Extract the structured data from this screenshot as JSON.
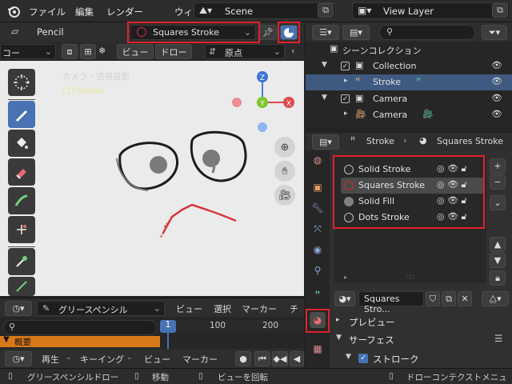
{
  "menubar": {
    "items": [
      "ファイル",
      "編集",
      "レンダー",
      "ウィンド"
    ],
    "scene": "Scene",
    "view_layer": "View Layer"
  },
  "viewport": {
    "editor_mode": "Pencil",
    "material_selector": "Squares Stroke",
    "mode_dropdown": "コー",
    "view_button": "ビュー",
    "draw_button": "ドロー",
    "origin_dropdown": "原点",
    "camera_label": "カメラ・透視投影",
    "object_label": "(1) Stroke",
    "gizmo": {
      "z": "Z",
      "y": "Y",
      "x": "X"
    }
  },
  "timeline": {
    "editor_label": "グリースペンシル",
    "menu": [
      "ビュー",
      "選択",
      "マーカー",
      "チャ"
    ],
    "frames": [
      "1",
      "100",
      "200"
    ],
    "summary": "概要",
    "playback": "再生",
    "keying": "キーイング",
    "view": "ビュー",
    "marker": "マーカー"
  },
  "statusbar": {
    "left": "グリースペンシルドロー",
    "move": "移動",
    "rotate": "ビューを回転",
    "right": "ドローコンテクストメニュ"
  },
  "outliner": {
    "search_placeholder": "",
    "rows": [
      {
        "label": "シーンコレクション"
      },
      {
        "label": "Collection"
      },
      {
        "label": "Stroke"
      },
      {
        "label": "Camera"
      },
      {
        "label": "Camera"
      }
    ]
  },
  "properties": {
    "breadcrumb_object": "Stroke",
    "breadcrumb_material": "Squares Stroke",
    "materials": [
      {
        "name": "Solid Stroke",
        "color": "#2b2b2b"
      },
      {
        "name": "Squares Stroke",
        "color": "#c8323a"
      },
      {
        "name": "Solid Fill",
        "color": "#808080"
      },
      {
        "name": "Dots Stroke",
        "color": "#2b2b2b"
      }
    ],
    "material_name": "Squares Stro...",
    "sections": [
      "プレビュー",
      "サーフェス",
      "ストローク"
    ]
  },
  "colors": {
    "highlight_red": "#e2212b",
    "selection_blue": "#4772b3",
    "outliner_selected": "#3f5a80",
    "playhead_blue": "#4772b3",
    "summary_orange": "#d9791a"
  }
}
